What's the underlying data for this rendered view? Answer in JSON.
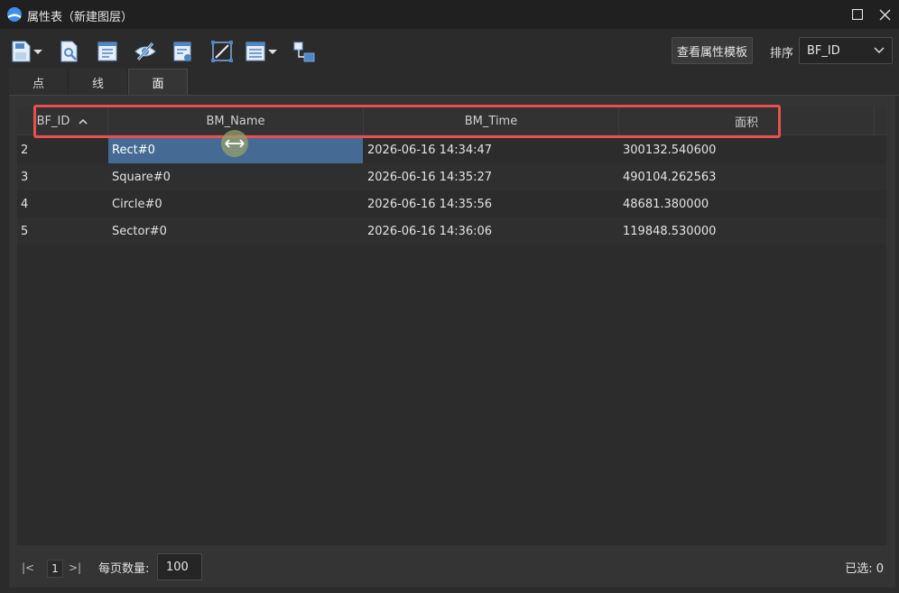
{
  "window": {
    "title": "属性表（新建图层）",
    "accent": "#3f8fe8"
  },
  "toolbar": {
    "icons": [
      "save-icon",
      "find-record-icon",
      "edit-field-icon",
      "hide-icon",
      "field-calc-icon",
      "zoom-to-icon",
      "table-options-icon",
      "relate-icon"
    ],
    "template_button": "查看属性模板",
    "sort_label": "排序",
    "sort_value": "BF_ID"
  },
  "tabs": [
    {
      "label": "点",
      "active": false
    },
    {
      "label": "线",
      "active": false
    },
    {
      "label": "面",
      "active": true
    }
  ],
  "table": {
    "columns": [
      "BF_ID",
      "BM_Name",
      "BM_Time",
      "面积"
    ],
    "sorted_column": "BF_ID",
    "rows": [
      {
        "id": "2",
        "name": "Rect#0",
        "time": "2026-06-16 14:34:47",
        "area": "300132.540600"
      },
      {
        "id": "3",
        "name": "Square#0",
        "time": "2026-06-16 14:35:27",
        "area": "490104.262563"
      },
      {
        "id": "4",
        "name": "Circle#0",
        "time": "2026-06-16 14:35:56",
        "area": "48681.380000"
      },
      {
        "id": "5",
        "name": "Sector#0",
        "time": "2026-06-16 14:36:06",
        "area": "119848.530000"
      }
    ],
    "selected_cell": {
      "row": 0,
      "column": "BM_Name"
    },
    "highlight_color": "#e85050"
  },
  "footer": {
    "page_first": "|<",
    "page_number": "1",
    "page_last": ">|",
    "per_page_label": "每页数量:",
    "per_page_value": "100",
    "selected_label": "已选:",
    "selected_count": "0"
  }
}
